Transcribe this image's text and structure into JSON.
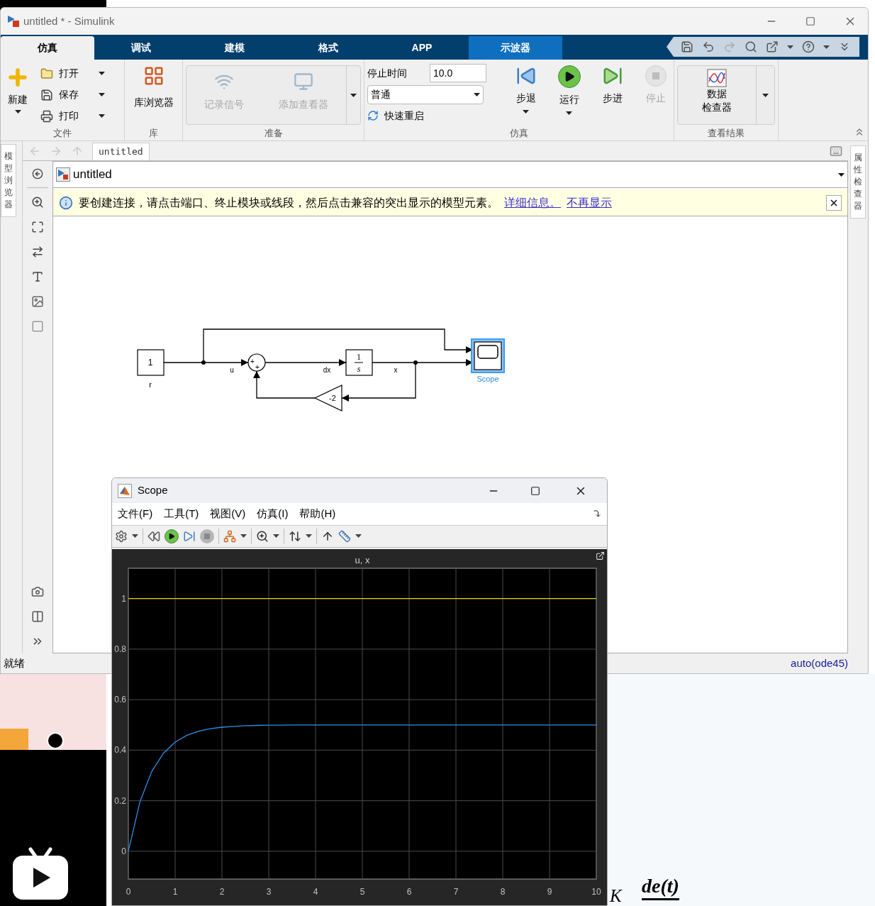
{
  "simulink_window": {
    "title": "untitled * - Simulink",
    "tabs": [
      {
        "label": "仿真",
        "selected": true,
        "kind": "normal"
      },
      {
        "label": "调试",
        "selected": false,
        "kind": "normal"
      },
      {
        "label": "建模",
        "selected": false,
        "kind": "normal"
      },
      {
        "label": "格式",
        "selected": false,
        "kind": "normal"
      },
      {
        "label": "APP",
        "selected": false,
        "kind": "normal"
      },
      {
        "label": "示波器",
        "selected": false,
        "kind": "contextual"
      }
    ],
    "ribbon": {
      "file_group": {
        "label": "文件",
        "new": "新建",
        "items": [
          "打开",
          "保存",
          "打印"
        ]
      },
      "library_group": {
        "label": "库",
        "button": "库浏览器"
      },
      "prepare_group": {
        "label": "准备",
        "buttons": [
          {
            "label": "记录信号",
            "disabled": true
          },
          {
            "label": "添加查看器",
            "disabled": true
          }
        ]
      },
      "simulation_group": {
        "label": "仿真",
        "stop_time_label": "停止时间",
        "stop_time": "10.0",
        "mode": "普通",
        "fast_restart": "快速重启",
        "buttons": [
          {
            "label": "步退",
            "disabled": false,
            "dropdown": true
          },
          {
            "label": "运行",
            "disabled": false,
            "dropdown": true
          },
          {
            "label": "步进",
            "disabled": false,
            "dropdown": false
          },
          {
            "label": "停止",
            "disabled": true,
            "dropdown": false
          }
        ]
      },
      "results_group": {
        "label": "查看结果",
        "button_lines": [
          "数据",
          "检查器"
        ]
      }
    },
    "left_dock_tab": "模型浏览器",
    "right_dock_tab": "属性检查器",
    "breadcrumb": "untitled",
    "address": "untitled",
    "info_bar": {
      "message": "要创建连接，请点击端口、终止模块或线段，然后点击兼容的突出显示的模型元素。",
      "links": [
        "详细信息。",
        "不再显示"
      ]
    },
    "diagram": {
      "constant": {
        "value": "1",
        "name": "r"
      },
      "sum": {
        "signs": [
          "+",
          "+"
        ]
      },
      "integrator": {
        "numerator": "1",
        "denominator": "s"
      },
      "gain": {
        "value": "-2"
      },
      "scope": {
        "name": "Scope",
        "selected": true
      },
      "signal_labels": [
        "u",
        "dx",
        "x"
      ]
    },
    "status_bar": {
      "status": "就绪",
      "solver": "auto(ode45)"
    }
  },
  "scope_window": {
    "title": "Scope",
    "menus": [
      "文件(F)",
      "工具(T)",
      "视图(V)",
      "仿真(I)",
      "帮助(H)"
    ],
    "chart_data": {
      "type": "line",
      "title": "u, x",
      "x": [
        0,
        0.25,
        0.5,
        0.75,
        1,
        1.25,
        1.5,
        1.75,
        2,
        2.25,
        2.5,
        2.75,
        3,
        3.25,
        3.5,
        3.75,
        4,
        4.25,
        4.5,
        4.75,
        5,
        5.25,
        5.5,
        5.75,
        6,
        6.25,
        6.5,
        6.75,
        7,
        7.25,
        7.5,
        7.75,
        8,
        8.25,
        8.5,
        8.75,
        9,
        9.25,
        9.5,
        9.75,
        10
      ],
      "grid": true,
      "series": [
        {
          "color": "#e6d200",
          "values": [
            1,
            1,
            1,
            1,
            1,
            1,
            1,
            1,
            1,
            1,
            1,
            1,
            1,
            1,
            1,
            1,
            1,
            1,
            1,
            1,
            1,
            1,
            1,
            1,
            1,
            1,
            1,
            1,
            1,
            1,
            1,
            1,
            1,
            1,
            1,
            1,
            1,
            1,
            1,
            1,
            1
          ]
        },
        {
          "color": "#2e8fe6",
          "values": [
            0,
            0.197,
            0.316,
            0.388,
            0.432,
            0.459,
            0.475,
            0.485,
            0.491,
            0.494,
            0.497,
            0.498,
            0.499,
            0.499,
            0.5,
            0.5,
            0.5,
            0.5,
            0.5,
            0.5,
            0.5,
            0.5,
            0.5,
            0.5,
            0.5,
            0.5,
            0.5,
            0.5,
            0.5,
            0.5,
            0.5,
            0.5,
            0.5,
            0.5,
            0.5,
            0.5,
            0.5,
            0.5,
            0.5,
            0.5,
            0.5
          ]
        }
      ],
      "xlim": [
        0,
        10
      ],
      "ylim": [
        -0.11,
        1.12
      ],
      "xticks": [
        0,
        1,
        2,
        3,
        4,
        5,
        6,
        7,
        8,
        9,
        10
      ],
      "yticks": [
        0,
        0.2,
        0.4,
        0.6,
        0.8,
        1
      ]
    }
  },
  "background_document": {
    "texts": [
      "K",
      "de(t)"
    ]
  }
}
